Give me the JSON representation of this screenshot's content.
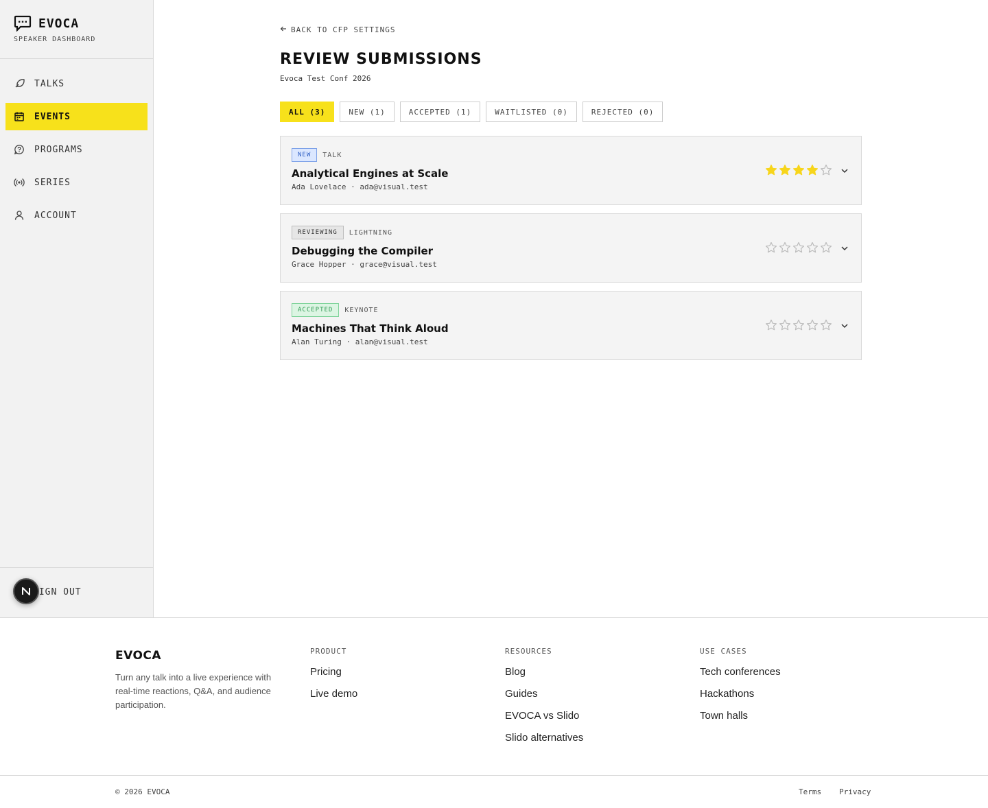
{
  "sidebar": {
    "brand": "EVOCA",
    "subtitle": "SPEAKER DASHBOARD",
    "items": [
      {
        "label": "TALKS",
        "icon": "quill-icon"
      },
      {
        "label": "EVENTS",
        "icon": "calendar-icon",
        "active": true
      },
      {
        "label": "PROGRAMS",
        "icon": "help-circle-icon"
      },
      {
        "label": "SERIES",
        "icon": "broadcast-icon"
      },
      {
        "label": "ACCOUNT",
        "icon": "user-icon"
      }
    ],
    "signout": "SIGN OUT",
    "n_badge": "N"
  },
  "main": {
    "back_label": "BACK TO CFP SETTINGS",
    "title": "REVIEW SUBMISSIONS",
    "subtitle": "Evoca Test Conf 2026",
    "filters": [
      {
        "label": "ALL (3)",
        "active": true
      },
      {
        "label": "NEW (1)"
      },
      {
        "label": "ACCEPTED (1)"
      },
      {
        "label": "WAITLISTED (0)"
      },
      {
        "label": "REJECTED (0)"
      }
    ],
    "submissions": [
      {
        "status": "NEW",
        "type": "TALK",
        "title": "Analytical Engines at Scale",
        "meta": "Ada Lovelace · ada@visual.test",
        "rating": 4,
        "max_rating": 5
      },
      {
        "status": "REVIEWING",
        "type": "LIGHTNING",
        "title": "Debugging the Compiler",
        "meta": "Grace Hopper · grace@visual.test",
        "rating": 0,
        "max_rating": 5
      },
      {
        "status": "ACCEPTED",
        "type": "KEYNOTE",
        "title": "Machines That Think Aloud",
        "meta": "Alan Turing · alan@visual.test",
        "rating": 0,
        "max_rating": 5
      }
    ]
  },
  "footer": {
    "brand": "EVOCA",
    "tagline": "Turn any talk into a live experience with real-time reactions, Q&A, and audience participation.",
    "columns": [
      {
        "heading": "PRODUCT",
        "links": [
          "Pricing",
          "Live demo"
        ]
      },
      {
        "heading": "RESOURCES",
        "links": [
          "Blog",
          "Guides",
          "EVOCA vs Slido",
          "Slido alternatives"
        ]
      },
      {
        "heading": "USE CASES",
        "links": [
          "Tech conferences",
          "Hackathons",
          "Town halls"
        ]
      }
    ],
    "copyright": "© 2026 EVOCA",
    "terms": "Terms",
    "privacy": "Privacy"
  },
  "colors": {
    "accent": "#f7e11b",
    "star_filled": "#f7d51b",
    "star_empty": "#bbbbbb",
    "sidebar_bg": "#f2f2f2"
  }
}
